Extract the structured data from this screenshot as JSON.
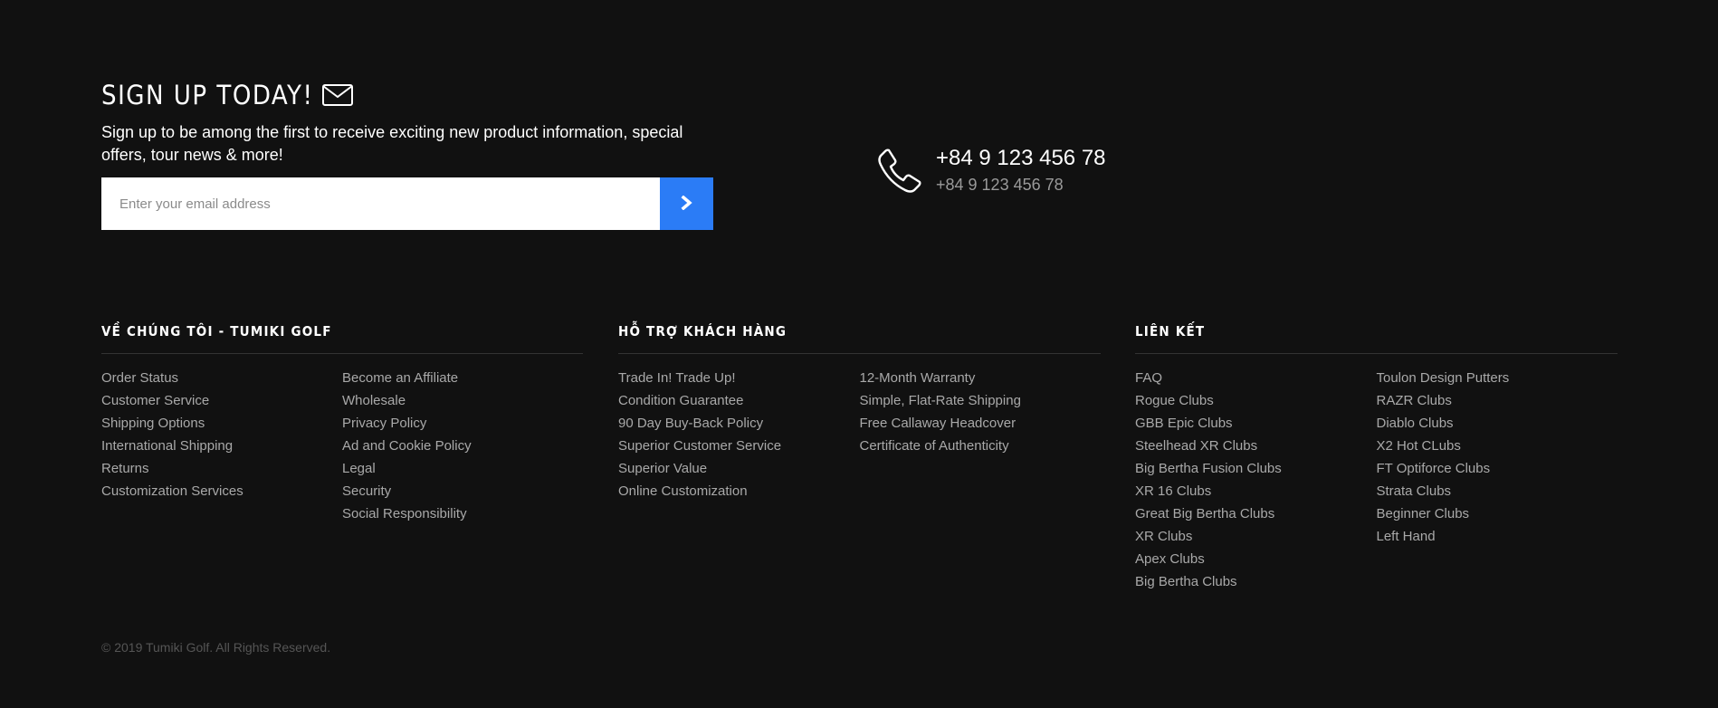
{
  "signup": {
    "title": "SIGN UP TODAY!",
    "description": "Sign up to be among the first to receive exciting new product information, special offers, tour news & more!",
    "email_placeholder": "Enter your email address",
    "submit_icon": "chevron-right-icon",
    "accent_color": "#2b7cf6"
  },
  "contact": {
    "icon": "phone-icon",
    "phone_primary": "+84 9 123 456 78",
    "phone_secondary": "+84 9 123 456 78"
  },
  "columns": [
    {
      "title": "VỀ CHÚNG TÔI - TUMIKI GOLF",
      "lists": [
        [
          "Order Status",
          "Customer Service",
          "Shipping Options",
          "International Shipping",
          "Returns",
          "Customization Services"
        ],
        [
          "Become an Affiliate",
          "Wholesale",
          "Privacy Policy",
          "Ad and Cookie Policy",
          "Legal",
          "Security",
          "Social Responsibility"
        ]
      ]
    },
    {
      "title": "HỖ TRỢ KHÁCH HÀNG",
      "lists": [
        [
          "Trade In! Trade Up!",
          "Condition Guarantee",
          "90 Day Buy-Back Policy",
          "Superior Customer Service",
          "Superior Value",
          "Online Customization"
        ],
        [
          "12-Month Warranty",
          "Simple, Flat-Rate Shipping",
          "Free Callaway Headcover",
          "Certificate of Authenticity"
        ]
      ]
    },
    {
      "title": "LIÊN KẾT",
      "lists": [
        [
          "FAQ",
          "Rogue Clubs",
          "GBB Epic Clubs",
          "Steelhead XR Clubs",
          "Big Bertha Fusion Clubs",
          "XR 16 Clubs",
          "Great Big Bertha Clubs",
          "XR Clubs",
          "Apex Clubs",
          "Big Bertha Clubs"
        ],
        [
          "Toulon Design Putters",
          "RAZR Clubs",
          "Diablo Clubs",
          "X2 Hot CLubs",
          "FT Optiforce Clubs",
          "Strata Clubs",
          "Beginner Clubs",
          "Left Hand"
        ]
      ]
    }
  ],
  "footer": {
    "copyright": "© 2019 Tumiki Golf. All Rights Reserved."
  }
}
